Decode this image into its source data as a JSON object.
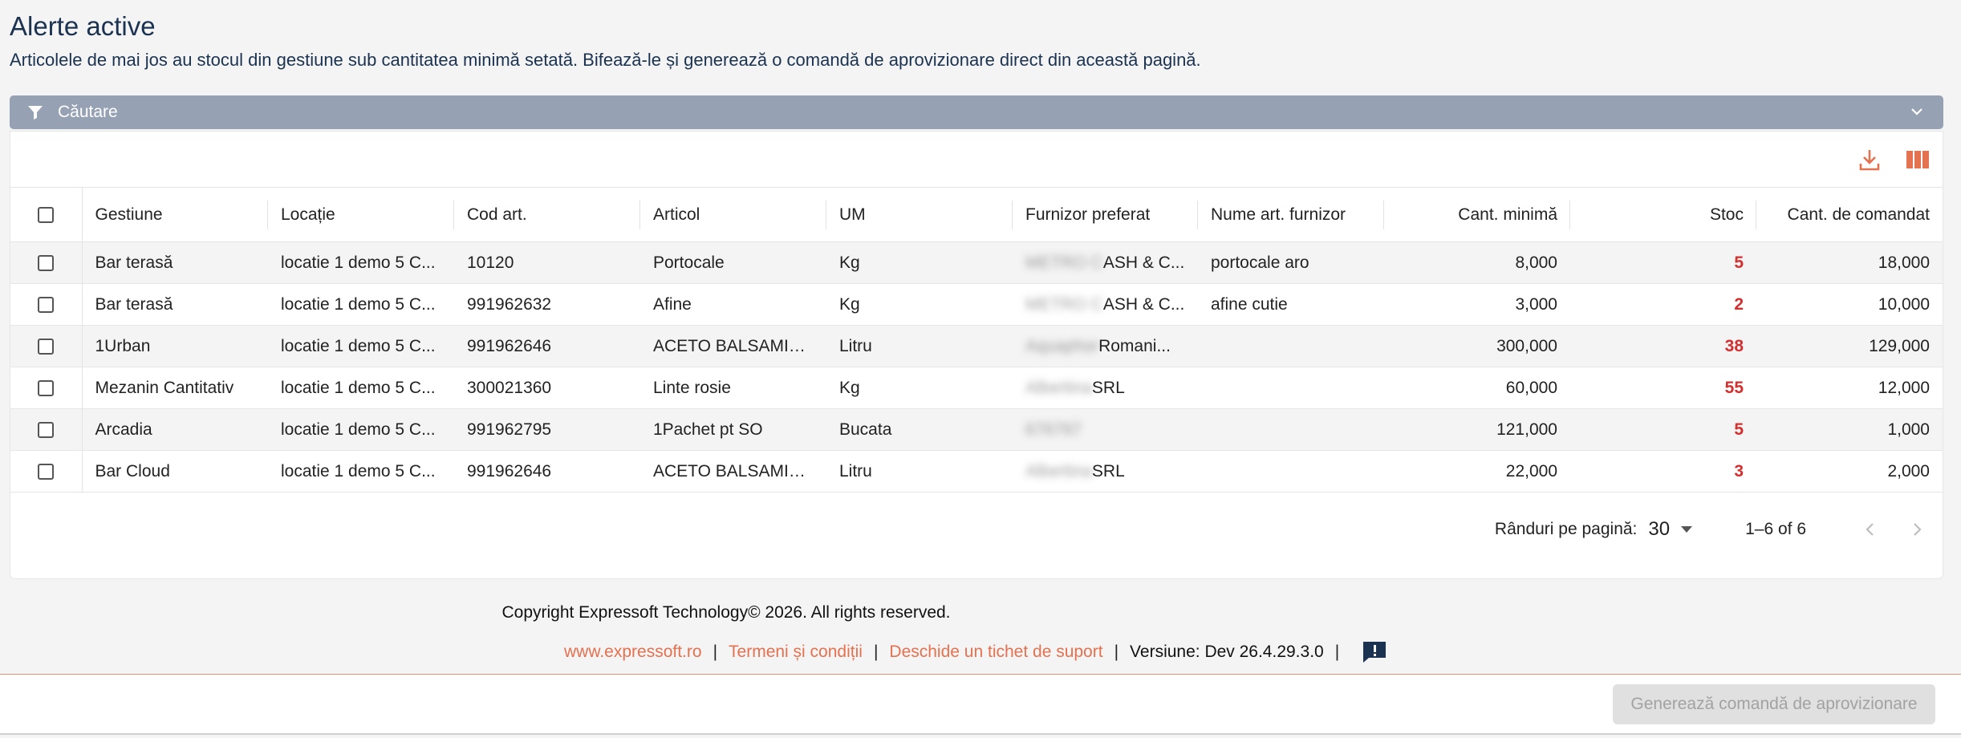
{
  "page": {
    "title": "Alerte active",
    "subtitle": "Articolele de mai jos au stocul din gestiune sub cantitatea minimă setată. Bifează-le și generează o comandă de aprovizionare direct din această pagină."
  },
  "filter": {
    "label": "Căutare"
  },
  "toolbar": {
    "download_icon": "download-icon",
    "columns_icon": "view-columns-icon",
    "accent_color": "#e4714f"
  },
  "table": {
    "columns": [
      "Gestiune",
      "Locație",
      "Cod art.",
      "Articol",
      "UM",
      "Furnizor preferat",
      "Nume art. furnizor",
      "Cant. minimă",
      "Stoc",
      "Cant. de comandat"
    ],
    "rows": [
      {
        "gestiune": "Bar terasă",
        "locatie": "locatie 1 demo 5 C...",
        "cod": "10120",
        "articol": "Portocale",
        "um": "Kg",
        "furnizor_hidden": "METRO C",
        "furnizor": "ASH & C...",
        "nume_furnizor": "portocale aro",
        "cant_min": "8,000",
        "stoc": "5",
        "cant_comandat": "18,000"
      },
      {
        "gestiune": "Bar terasă",
        "locatie": "locatie 1 demo 5 C...",
        "cod": "991962632",
        "articol": "Afine",
        "um": "Kg",
        "furnizor_hidden": "METRO C",
        "furnizor": "ASH & C...",
        "nume_furnizor": "afine cutie",
        "cant_min": "3,000",
        "stoc": "2",
        "cant_comandat": "10,000"
      },
      {
        "gestiune": "1Urban",
        "locatie": "locatie 1 demo 5 C...",
        "cod": "991962646",
        "articol": "ACETO BALSAMIC...",
        "um": "Litru",
        "furnizor_hidden": "Aquaphor",
        "furnizor": "Romani...",
        "nume_furnizor": "",
        "cant_min": "300,000",
        "stoc": "38",
        "cant_comandat": "129,000"
      },
      {
        "gestiune": "Mezanin Cantitativ",
        "locatie": "locatie 1 demo 5 C...",
        "cod": "300021360",
        "articol": "Linte rosie",
        "um": "Kg",
        "furnizor_hidden": "Albertina",
        "furnizor": "SRL",
        "nume_furnizor": "",
        "cant_min": "60,000",
        "stoc": "55",
        "cant_comandat": "12,000"
      },
      {
        "gestiune": "Arcadia",
        "locatie": "locatie 1 demo 5 C...",
        "cod": "991962795",
        "articol": "1Pachet pt SO",
        "um": "Bucata",
        "furnizor_hidden": "676767",
        "furnizor": "",
        "nume_furnizor": "",
        "cant_min": "121,000",
        "stoc": "5",
        "cant_comandat": "1,000"
      },
      {
        "gestiune": "Bar Cloud",
        "locatie": "locatie 1 demo 5 C...",
        "cod": "991962646",
        "articol": "ACETO BALSAMIC...",
        "um": "Litru",
        "furnizor_hidden": "Albertina",
        "furnizor": "SRL",
        "nume_furnizor": "",
        "cant_min": "22,000",
        "stoc": "3",
        "cant_comandat": "2,000"
      }
    ]
  },
  "pagination": {
    "rows_label": "Rânduri pe pagină:",
    "rows_value": "30",
    "range": "1–6 of 6"
  },
  "footer": {
    "copyright": "Copyright Expressoft Technology© 2026. All rights reserved.",
    "link_site": "www.expressoft.ro",
    "link_terms": "Termeni și condiții",
    "link_ticket": "Deschide un tichet de suport",
    "version": "Versiune: Dev 26.4.29.3.0",
    "separator": "|"
  },
  "actions": {
    "submit_label": "Generează comandă de aprovizionare"
  }
}
